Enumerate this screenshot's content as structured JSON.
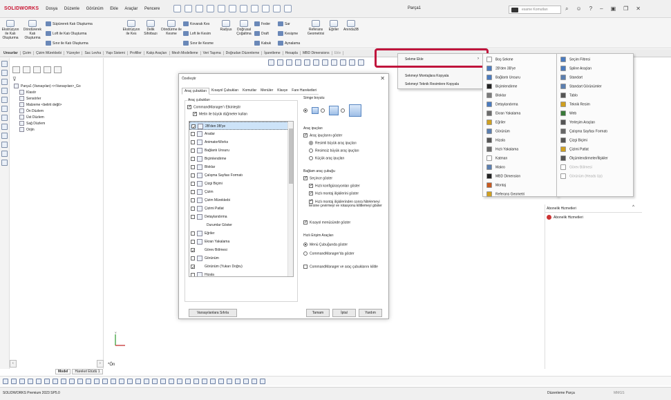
{
  "app": {
    "logo": "SOLIDWORKS",
    "menu": [
      "Dosya",
      "Düzenle",
      "Görünüm",
      "Ekle",
      "Araçlar",
      "Pencere"
    ],
    "doc_title": "Parça1",
    "search_placeholder": "esame Komutları"
  },
  "ribbon": {
    "buttons": [
      {
        "label": "Ekstrüzyon ile Katı Oluşturma"
      },
      {
        "label": "Döndürerek Katı Oluşturma"
      },
      {
        "label": "Süpürerek Katı Oluşturma"
      },
      {
        "label": "Loft ile Katı Oluşturma"
      },
      {
        "label": "Sınır ile Katı Oluşturma"
      },
      {
        "label": "Ekstrüzyon ile Kes"
      },
      {
        "label": "Delik Sihirbazı"
      },
      {
        "label": "Döndürme ile Kesme"
      },
      {
        "label": "Kovarak Kes"
      },
      {
        "label": "Loft ile Kesim"
      },
      {
        "label": "Sınır ile Kesme"
      },
      {
        "label": "Radyus"
      },
      {
        "label": "Doğrusal Çoğaltma"
      },
      {
        "label": "Feder"
      },
      {
        "label": "Draft"
      },
      {
        "label": "Kabuk"
      },
      {
        "label": "Sar"
      },
      {
        "label": "Kesişme"
      },
      {
        "label": "Aynalama"
      },
      {
        "label": "Referans Geometrisi"
      },
      {
        "label": "Eğriler"
      },
      {
        "label": "Anında3B"
      }
    ]
  },
  "tabs": [
    "Unsurlar",
    "Çizim",
    "Çizim Mürekkebi",
    "Yüzeyler",
    "Sac Levha",
    "Yapı Sistemi",
    "Profiller",
    "Kalıp Araçları",
    "Mesh Modelleme",
    "Veri Taşıma",
    "Doğrudan Düzenleme",
    "İşaretleme",
    "Hesapla",
    "MBD Dimensions",
    "Ekle"
  ],
  "feature_tree": {
    "root": "Parça1 (Varsayılan) <<Varsayılan>_Go",
    "items": [
      "Klasör",
      "Sensörler",
      "Malzeme <belirti değil>",
      "Ön Düzlem",
      "Üst Düzlem",
      "Sağ Düzlem",
      "Orijin"
    ]
  },
  "dialog": {
    "title": "Özelleştir",
    "close": "✕",
    "tabs": [
      "Araç çubukları",
      "Kısayol Çubukları",
      "Komutlar",
      "Menüler",
      "Klavye",
      "Fare Hareketleri"
    ],
    "toolbars_group": "Araç çubukları",
    "cm_label": "CommandManager'ı Etkinleştir",
    "large_buttons_label": "Metin ile büyük düğmeler kullan",
    "toolbar_list": [
      {
        "label": "2B'den 3B'ye",
        "checked": true,
        "selected": true,
        "icon": true
      },
      {
        "label": "Aradar",
        "checked": false,
        "icon": true
      },
      {
        "label": "AnimatorWorks",
        "checked": false,
        "icon": true
      },
      {
        "label": "Bağlantı Unsuru",
        "checked": false,
        "icon": true
      },
      {
        "label": "Biçimlendirme",
        "checked": false,
        "icon": true
      },
      {
        "label": "Bloklar",
        "checked": false,
        "icon": true
      },
      {
        "label": "Çalışma Sayfası Formatı",
        "checked": false,
        "icon": true
      },
      {
        "label": "Çizgi Biçimi",
        "checked": false,
        "icon": true
      },
      {
        "label": "Çizim",
        "checked": false,
        "icon": true
      },
      {
        "label": "Çizim Mürekkebi",
        "checked": false,
        "icon": true
      },
      {
        "label": "Çizimi Patlat",
        "checked": false,
        "icon": true
      },
      {
        "label": "Detaylandırma",
        "checked": false,
        "icon": true
      },
      {
        "label": "Durumlar Göster",
        "checked": false,
        "icon": false
      },
      {
        "label": "Eğriler",
        "checked": false,
        "icon": true
      },
      {
        "label": "Ekran Yakalama",
        "checked": false,
        "icon": true
      },
      {
        "label": "Görev Bölmesi",
        "checked": true,
        "icon": false
      },
      {
        "label": "Görünüm",
        "checked": false,
        "icon": true
      },
      {
        "label": "Görünüm (Yukarı Doğru)",
        "checked": true,
        "icon": false
      },
      {
        "label": "Hizala",
        "checked": false,
        "icon": true
      }
    ],
    "icon_size_group": "Simge boyutu",
    "tooltips_group": "Araç ipuçları",
    "show_tooltips": "Araç ipuçlarını göster",
    "large_tooltips": "Resimli büyük araç ipuçları",
    "large_tooltips_no_img": "Resimsiz büyük araç ipuçları",
    "small_tooltips": "Küçük araç ipuçları",
    "context_group": "Bağlam araç çubuğu",
    "show_in_selection": "Seçince göster",
    "show_quick_config": "Hızlı konfigürasyonları göster",
    "show_quick_mates": "Hızlı montaj ilişkilerini göster",
    "mates_transparency": "Hızlı montaj ilişkilerinden sonra Nitelemeyi tersine çevirmeyi ve rotasyonu kilitlemeyi göster",
    "shortcut_menu": "Kısayol menüsünde göster",
    "quick_access_group": "Hızlı Erişim Araçları",
    "qa_menu": "Menü Çubuğunda göster",
    "qa_cm": "CommandManager'da göster",
    "qa_lock": "CommandManager ve araç çubuklarını kilitle",
    "reset": "Varsayılanlara Sıfırla",
    "ok": "Tamam",
    "cancel": "İptal",
    "help": "Yardım"
  },
  "context_menu": {
    "items": [
      "Sekme Ekle",
      "Sekmeyi Montajlara Kopyala",
      "Sekmeyi Teknik Resimlere Kopyala"
    ],
    "arrow": "›"
  },
  "submenu1": {
    "items": [
      {
        "label": "Boş Sekme",
        "color": "#ffffff"
      },
      {
        "label": "2B'den 3B'ye",
        "color": "#4a7bbf"
      },
      {
        "label": "Bağlantı Unsuru",
        "color": "#4a7bbf"
      },
      {
        "label": "Biçimlendirme",
        "color": "#222222"
      },
      {
        "label": "Bloklar",
        "color": "#7a7a7a"
      },
      {
        "label": "Detaylandırma",
        "color": "#4a7bbf"
      },
      {
        "label": "Ekran Yakalama",
        "color": "#6b6b6b"
      },
      {
        "label": "Eğriler",
        "color": "#d0a020"
      },
      {
        "label": "Görünüm",
        "color": "#5b7fb0"
      },
      {
        "label": "Hizala",
        "color": "#555555"
      },
      {
        "label": "Hızlı Yakalama",
        "color": "#6b6b6b"
      },
      {
        "label": "Katman",
        "color": "#ffffff"
      },
      {
        "label": "Makro",
        "color": "#5b7fb0"
      },
      {
        "label": "MBD Dimension",
        "color": "#222222"
      },
      {
        "label": "Montaj",
        "color": "#c85a20"
      },
      {
        "label": "Referans Geometri",
        "color": "#d0a020"
      }
    ]
  },
  "submenu2": {
    "items": [
      {
        "label": "Seçim Filtresi",
        "color": "#4a7bbf",
        "dis": false
      },
      {
        "label": "Spline Araçları",
        "color": "#4a7bbf",
        "dis": false
      },
      {
        "label": "Standart",
        "color": "#5b7fb0",
        "dis": false
      },
      {
        "label": "Standart Görünümler",
        "color": "#5b7fb0",
        "dis": false
      },
      {
        "label": "Tablo",
        "color": "#555555",
        "dis": false
      },
      {
        "label": "Teknik Resim",
        "color": "#d0a020",
        "dis": false
      },
      {
        "label": "Web",
        "color": "#3a7a3a",
        "dis": false
      },
      {
        "label": "Yerleşim Araçları",
        "color": "#555555",
        "dis": false
      },
      {
        "label": "Çalışma Sayfası Formatı",
        "color": "#666666",
        "dis": false
      },
      {
        "label": "Çizgi Biçimi",
        "color": "#555555",
        "dis": false
      },
      {
        "label": "Çizimi Patlat",
        "color": "#d0a020",
        "dis": false
      },
      {
        "label": "Ölçümlendirmeler/İlişkiler",
        "color": "#555555",
        "dis": false
      },
      {
        "label": "Görev Bölmesi",
        "color": "#ffffff",
        "dis": true
      },
      {
        "label": "Görünüm (Heads Up)",
        "color": "#ffffff",
        "dis": true
      }
    ]
  },
  "task_pane": {
    "header": "Abonelik Hizmetleri",
    "item": "Abonelik Hizmetleri",
    "collapse": "^"
  },
  "bottom": {
    "tab_model": "Model",
    "tab_motion": "Hareket Etüdü 1",
    "on_label": "*Ön"
  },
  "status": {
    "left": "SOLIDWORKS Premium 2023 SP5.0",
    "mode": "Düzenleme Parça",
    "units": "MMGS"
  }
}
